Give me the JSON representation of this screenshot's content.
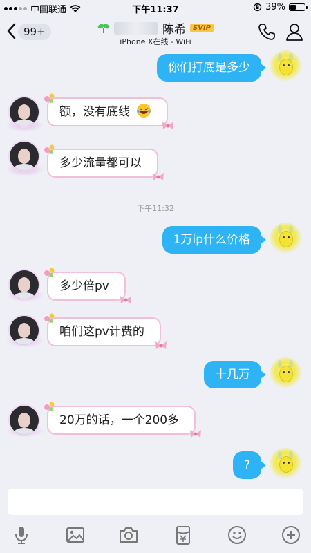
{
  "status_bar": {
    "carrier": "中国联通",
    "time": "下午11:37",
    "battery_pct": "39%",
    "battery_level": 0.39
  },
  "nav": {
    "unread_count": "99+",
    "contact_name": "陈希",
    "vip_badge": "SVIP",
    "device_status": "iPhone X在线 - WiFi"
  },
  "colors": {
    "outgoing_bubble": "#2eb4f4",
    "incoming_border": "#f3bfd8",
    "background": "#eef0f6"
  },
  "messages": [
    {
      "dir": "out",
      "text": "你们打底是多少"
    },
    {
      "dir": "in",
      "text": "额，没有底线",
      "emoji": "laughing-crying-emoji"
    },
    {
      "dir": "in",
      "text": "多少流量都可以"
    },
    {
      "dir": "time",
      "text": "下午11:32"
    },
    {
      "dir": "out",
      "text": "1万ip什么价格"
    },
    {
      "dir": "in",
      "text": "多少倍pv"
    },
    {
      "dir": "in",
      "text": "咱们这pv计费的"
    },
    {
      "dir": "out",
      "text": "十几万"
    },
    {
      "dir": "in",
      "text": "20万的话，一个200多"
    },
    {
      "dir": "out",
      "text": "?"
    }
  ],
  "input": {
    "placeholder": ""
  },
  "toolbar_icons": [
    "microphone-icon",
    "image-icon",
    "camera-icon",
    "red-packet-icon",
    "emoji-icon",
    "plus-icon"
  ]
}
